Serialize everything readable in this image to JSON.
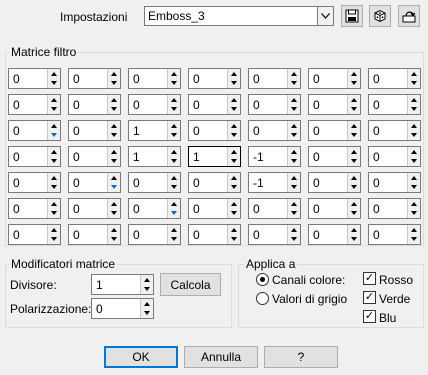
{
  "preset": {
    "label": "Impostazioni",
    "value": "Emboss_3"
  },
  "matrix": {
    "title": "Matrice filtro",
    "rows": [
      [
        "0",
        "0",
        "0",
        "0",
        "0",
        "0",
        "0"
      ],
      [
        "0",
        "0",
        "0",
        "0",
        "0",
        "0",
        "0"
      ],
      [
        "0",
        "0",
        "1",
        "0",
        "0",
        "0",
        "0"
      ],
      [
        "0",
        "0",
        "1",
        "1",
        "-1",
        "0",
        "0"
      ],
      [
        "0",
        "0",
        "0",
        "0",
        "-1",
        "0",
        "0"
      ],
      [
        "0",
        "0",
        "0",
        "0",
        "0",
        "0",
        "0"
      ],
      [
        "0",
        "0",
        "0",
        "0",
        "0",
        "0",
        "0"
      ]
    ]
  },
  "modifiers": {
    "title": "Modificatori matrice",
    "divisor_label": "Divisore:",
    "divisor_value": "1",
    "bias_label": "Polarizzazione:",
    "bias_value": "0",
    "calc_label": "Calcola"
  },
  "apply": {
    "title": "Applica a",
    "color_channels": "Canali colore:",
    "grayscale": "Valori di grigio",
    "red": "Rosso",
    "green": "Verde",
    "blue": "Blu",
    "selected": "color_channels"
  },
  "buttons": {
    "ok": "OK",
    "cancel": "Annulla",
    "help": "?"
  }
}
